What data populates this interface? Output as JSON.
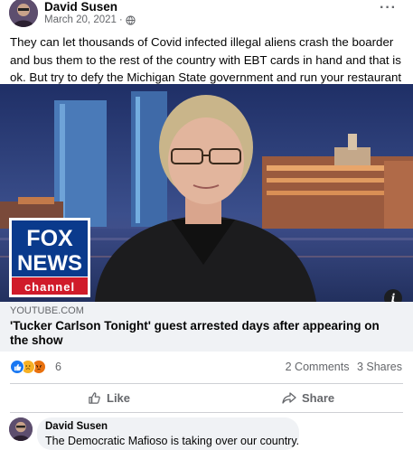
{
  "post": {
    "author": "David Susen",
    "date": "March 20, 2021",
    "separator": "·",
    "privacy_icon": "globe-icon",
    "more_icon": "more-options-icon",
    "text": "They can let thousands of Covid infected illegal aliens crash the boarder and bus them to the rest of the country with EBT cards in hand and that is ok. But try to defy the Michigan State government and run your restaurant and you go to jail!"
  },
  "media": {
    "logo_line1": "FOX",
    "logo_line2": "NEWS",
    "logo_line3": "channel",
    "info_glyph": "i",
    "colors": {
      "fox_blue": "#0a3a8c",
      "fox_red": "#d01b2a",
      "sky": "#2a3f7a"
    }
  },
  "link": {
    "domain": "YOUTUBE.COM",
    "title": "'Tucker Carlson Tonight' guest arrested days after appearing on the show"
  },
  "reactions": {
    "icons": [
      "like-icon",
      "sad-icon",
      "angry-icon"
    ],
    "count": "6",
    "comments": "2 Comments",
    "shares": "3 Shares"
  },
  "actions": {
    "like_label": "Like",
    "share_label": "Share"
  },
  "comment": {
    "author": "David Susen",
    "text": "The Democratic Mafioso is taking over our country."
  },
  "colors": {
    "accent": "#1877f2",
    "secondary_text": "#65676b",
    "bubble_bg": "#f0f2f5"
  }
}
